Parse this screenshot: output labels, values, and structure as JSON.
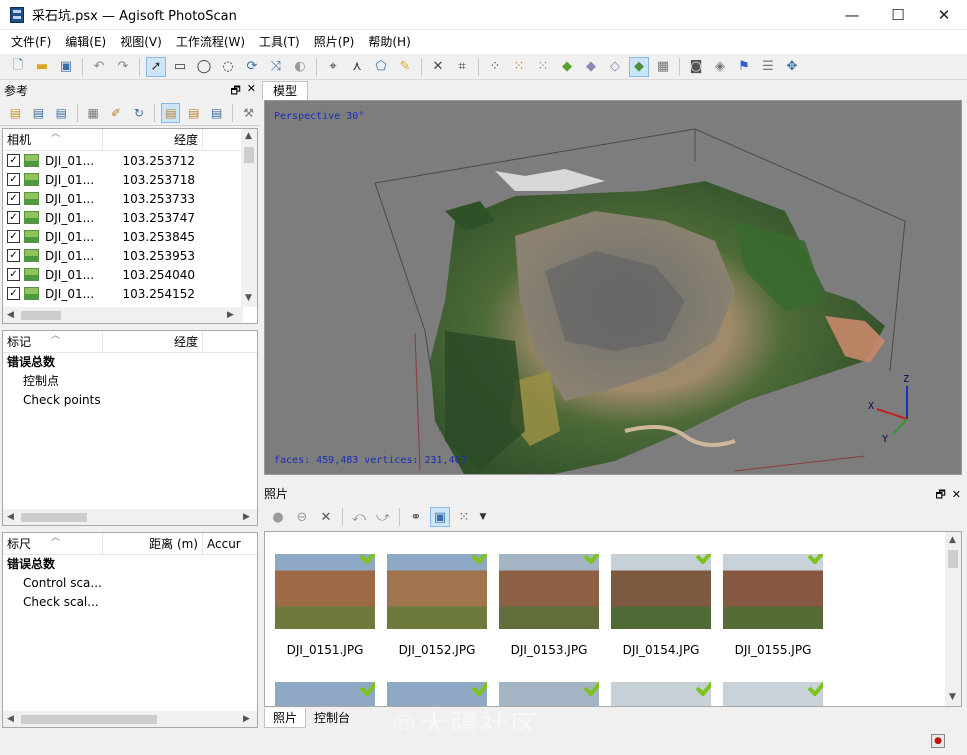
{
  "window": {
    "title": "采石坑.psx — Agisoft PhotoScan",
    "controls": [
      "—",
      "☐",
      "✕"
    ]
  },
  "menu": [
    "文件(F)",
    "编辑(E)",
    "视图(V)",
    "工作流程(W)",
    "工具(T)",
    "照片(P)",
    "帮助(H)"
  ],
  "reference_pane": {
    "title": "参考",
    "cameras": {
      "col_name": "相机",
      "col_lon": "经度",
      "rows": [
        {
          "name": "DJI_01...",
          "lon": "103.253712"
        },
        {
          "name": "DJI_01...",
          "lon": "103.253718"
        },
        {
          "name": "DJI_01...",
          "lon": "103.253733"
        },
        {
          "name": "DJI_01...",
          "lon": "103.253747"
        },
        {
          "name": "DJI_01...",
          "lon": "103.253845"
        },
        {
          "name": "DJI_01...",
          "lon": "103.253953"
        },
        {
          "name": "DJI_01...",
          "lon": "103.254040"
        },
        {
          "name": "DJI_01...",
          "lon": "103.254152"
        }
      ]
    },
    "markers": {
      "col_name": "标记",
      "col_lon": "经度",
      "group": "错误总数",
      "items": [
        "控制点",
        "Check points"
      ]
    },
    "scalebars": {
      "col_name": "标尺",
      "col_dist": "距离 (m)",
      "col_acc": "Accur",
      "group": "错误总数",
      "items": [
        "Control sca...",
        "Check scal..."
      ]
    }
  },
  "model": {
    "tab": "模型",
    "projection": "Perspective 30°",
    "stats": "faces: 459,483 vertices: 231,403",
    "axes": {
      "x": "X",
      "y": "Y",
      "z": "Z"
    }
  },
  "photos_pane": {
    "title": "照片",
    "thumbnails": [
      {
        "name": "DJI_0151.JPG",
        "checked": true
      },
      {
        "name": "DJI_0152.JPG",
        "checked": true
      },
      {
        "name": "DJI_0153.JPG",
        "checked": true
      },
      {
        "name": "DJI_0154.JPG",
        "checked": true
      },
      {
        "name": "DJI_0155.JPG",
        "checked": true
      }
    ],
    "second_row_count": 5
  },
  "bottom_tabs": [
    "照片",
    "控制台"
  ],
  "watermark": "©大疆社区",
  "colors": {
    "viewport_bg": "#7d7d7d",
    "overlay_text": "#1a2dbb",
    "check_green": "#7dc21e"
  }
}
